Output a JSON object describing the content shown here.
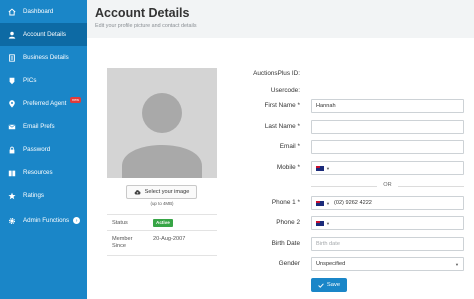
{
  "sidebar": {
    "items": [
      {
        "label": "Dashboard",
        "icon": "home-icon"
      },
      {
        "label": "Account Details",
        "icon": "user-icon",
        "active": true
      },
      {
        "label": "Business Details",
        "icon": "document-icon"
      },
      {
        "label": "PICs",
        "icon": "pin-icon"
      },
      {
        "label": "Preferred Agent",
        "icon": "location-pin-icon",
        "badge": "new"
      },
      {
        "label": "Email Prefs",
        "icon": "email-icon"
      },
      {
        "label": "Password",
        "icon": "lock-icon"
      },
      {
        "label": "Resources",
        "icon": "book-icon"
      },
      {
        "label": "Ratings",
        "icon": "star-icon"
      },
      {
        "label": "Admin Functions",
        "icon": "gear-icon",
        "chevron": "›"
      }
    ]
  },
  "header": {
    "title": "Account Details",
    "subtitle": "Edit your profile picture and contact details"
  },
  "profile": {
    "select_image_label": "Select your image",
    "upload_limit": "(up to 4MB)",
    "status_label": "Status",
    "status_value": "Active",
    "member_since_label_1": "Member",
    "member_since_label_2": "Since",
    "member_since_value": "20-Aug-2007"
  },
  "form": {
    "auctionsplus_id_label": "AuctionsPlus ID:",
    "usercode_label": "Usercode:",
    "first_name_label": "First Name *",
    "first_name_value": "Hannah",
    "last_name_label": "Last Name *",
    "last_name_value": "",
    "email_label": "Email *",
    "email_value": "",
    "mobile_label": "Mobile *",
    "mobile_value": "",
    "or_text": "OR",
    "phone1_label": "Phone 1 *",
    "phone1_value": "(02) 9262 4222",
    "phone2_label": "Phone 2",
    "phone2_value": "",
    "birth_date_label": "Birth Date",
    "birth_date_placeholder": "Birth date",
    "gender_label": "Gender",
    "gender_value": "Unspecified",
    "save_label": "Save"
  },
  "colors": {
    "sidebar_bg": "#1a86c8",
    "sidebar_active": "#0d6aa4",
    "status_active": "#37a546",
    "new_badge": "#e23b3b"
  }
}
